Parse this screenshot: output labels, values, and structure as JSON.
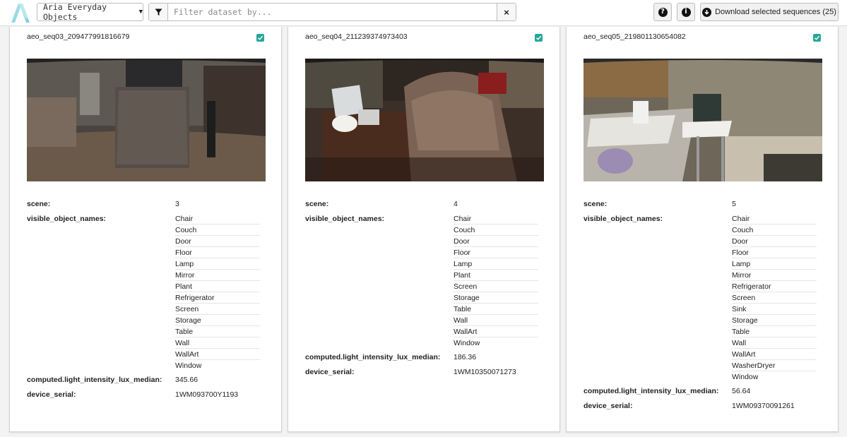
{
  "toolbar": {
    "dataset": "Aria Everyday Objects",
    "filter_placeholder": "Filter dataset by...",
    "download_label": "Download selected sequences (25)"
  },
  "labels": {
    "scene": "scene:",
    "objects": "visible_object_names:",
    "lux": "computed.light_intensity_lux_median:",
    "serial": "device_serial:"
  },
  "cards": [
    {
      "title": "aeo_seq03_209477991816679",
      "selected": true,
      "scene": "3",
      "objects": [
        "Chair",
        "Couch",
        "Door",
        "Floor",
        "Lamp",
        "Mirror",
        "Plant",
        "Refrigerator",
        "Screen",
        "Storage",
        "Table",
        "Wall",
        "WallArt",
        "Window"
      ],
      "lux": "345.66",
      "serial": "1WM093700Y1193"
    },
    {
      "title": "aeo_seq04_211239374973403",
      "selected": true,
      "scene": "4",
      "objects": [
        "Chair",
        "Couch",
        "Door",
        "Floor",
        "Lamp",
        "Plant",
        "Screen",
        "Storage",
        "Table",
        "Wall",
        "WallArt",
        "Window"
      ],
      "lux": "186.36",
      "serial": "1WM10350071273"
    },
    {
      "title": "aeo_seq05_219801130654082",
      "selected": true,
      "scene": "5",
      "objects": [
        "Chair",
        "Couch",
        "Door",
        "Floor",
        "Lamp",
        "Mirror",
        "Refrigerator",
        "Screen",
        "Sink",
        "Storage",
        "Table",
        "Wall",
        "WallArt",
        "WasherDryer",
        "Window"
      ],
      "lux": "56.64",
      "serial": "1WM09370091261"
    }
  ]
}
